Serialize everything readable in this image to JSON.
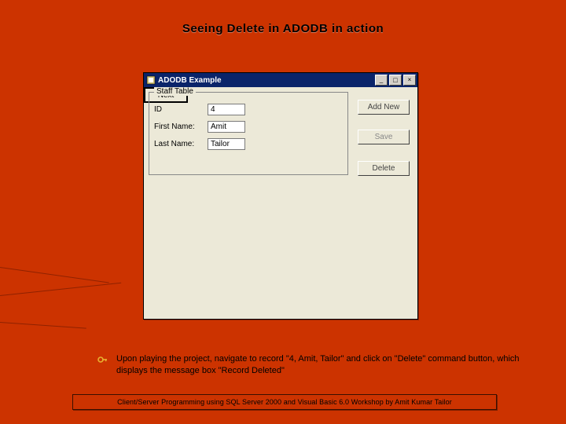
{
  "slide_title": "Seeing Delete in ADODB in action",
  "window": {
    "title": "ADODB Example",
    "min": "_",
    "max": "□",
    "close": "×"
  },
  "group": {
    "legend": "Staff Table",
    "id_label": "ID",
    "id_value": "4",
    "fn_label": "First Name:",
    "fn_value": "Amit",
    "ln_label": "Last Name:",
    "ln_value": "Tailor"
  },
  "buttons": {
    "addnew": "Add New",
    "save": "Save",
    "delete": "Delete",
    "next": "Next"
  },
  "bullet_text": "Upon playing the project, navigate to record \"4, Amit, Tailor\" and click on \"Delete\" command button, which displays the message box \"Record Deleted\"",
  "footer": "Client/Server Programming using SQL Server 2000 and Visual Basic 6.0 Workshop by Amit Kumar Tailor"
}
